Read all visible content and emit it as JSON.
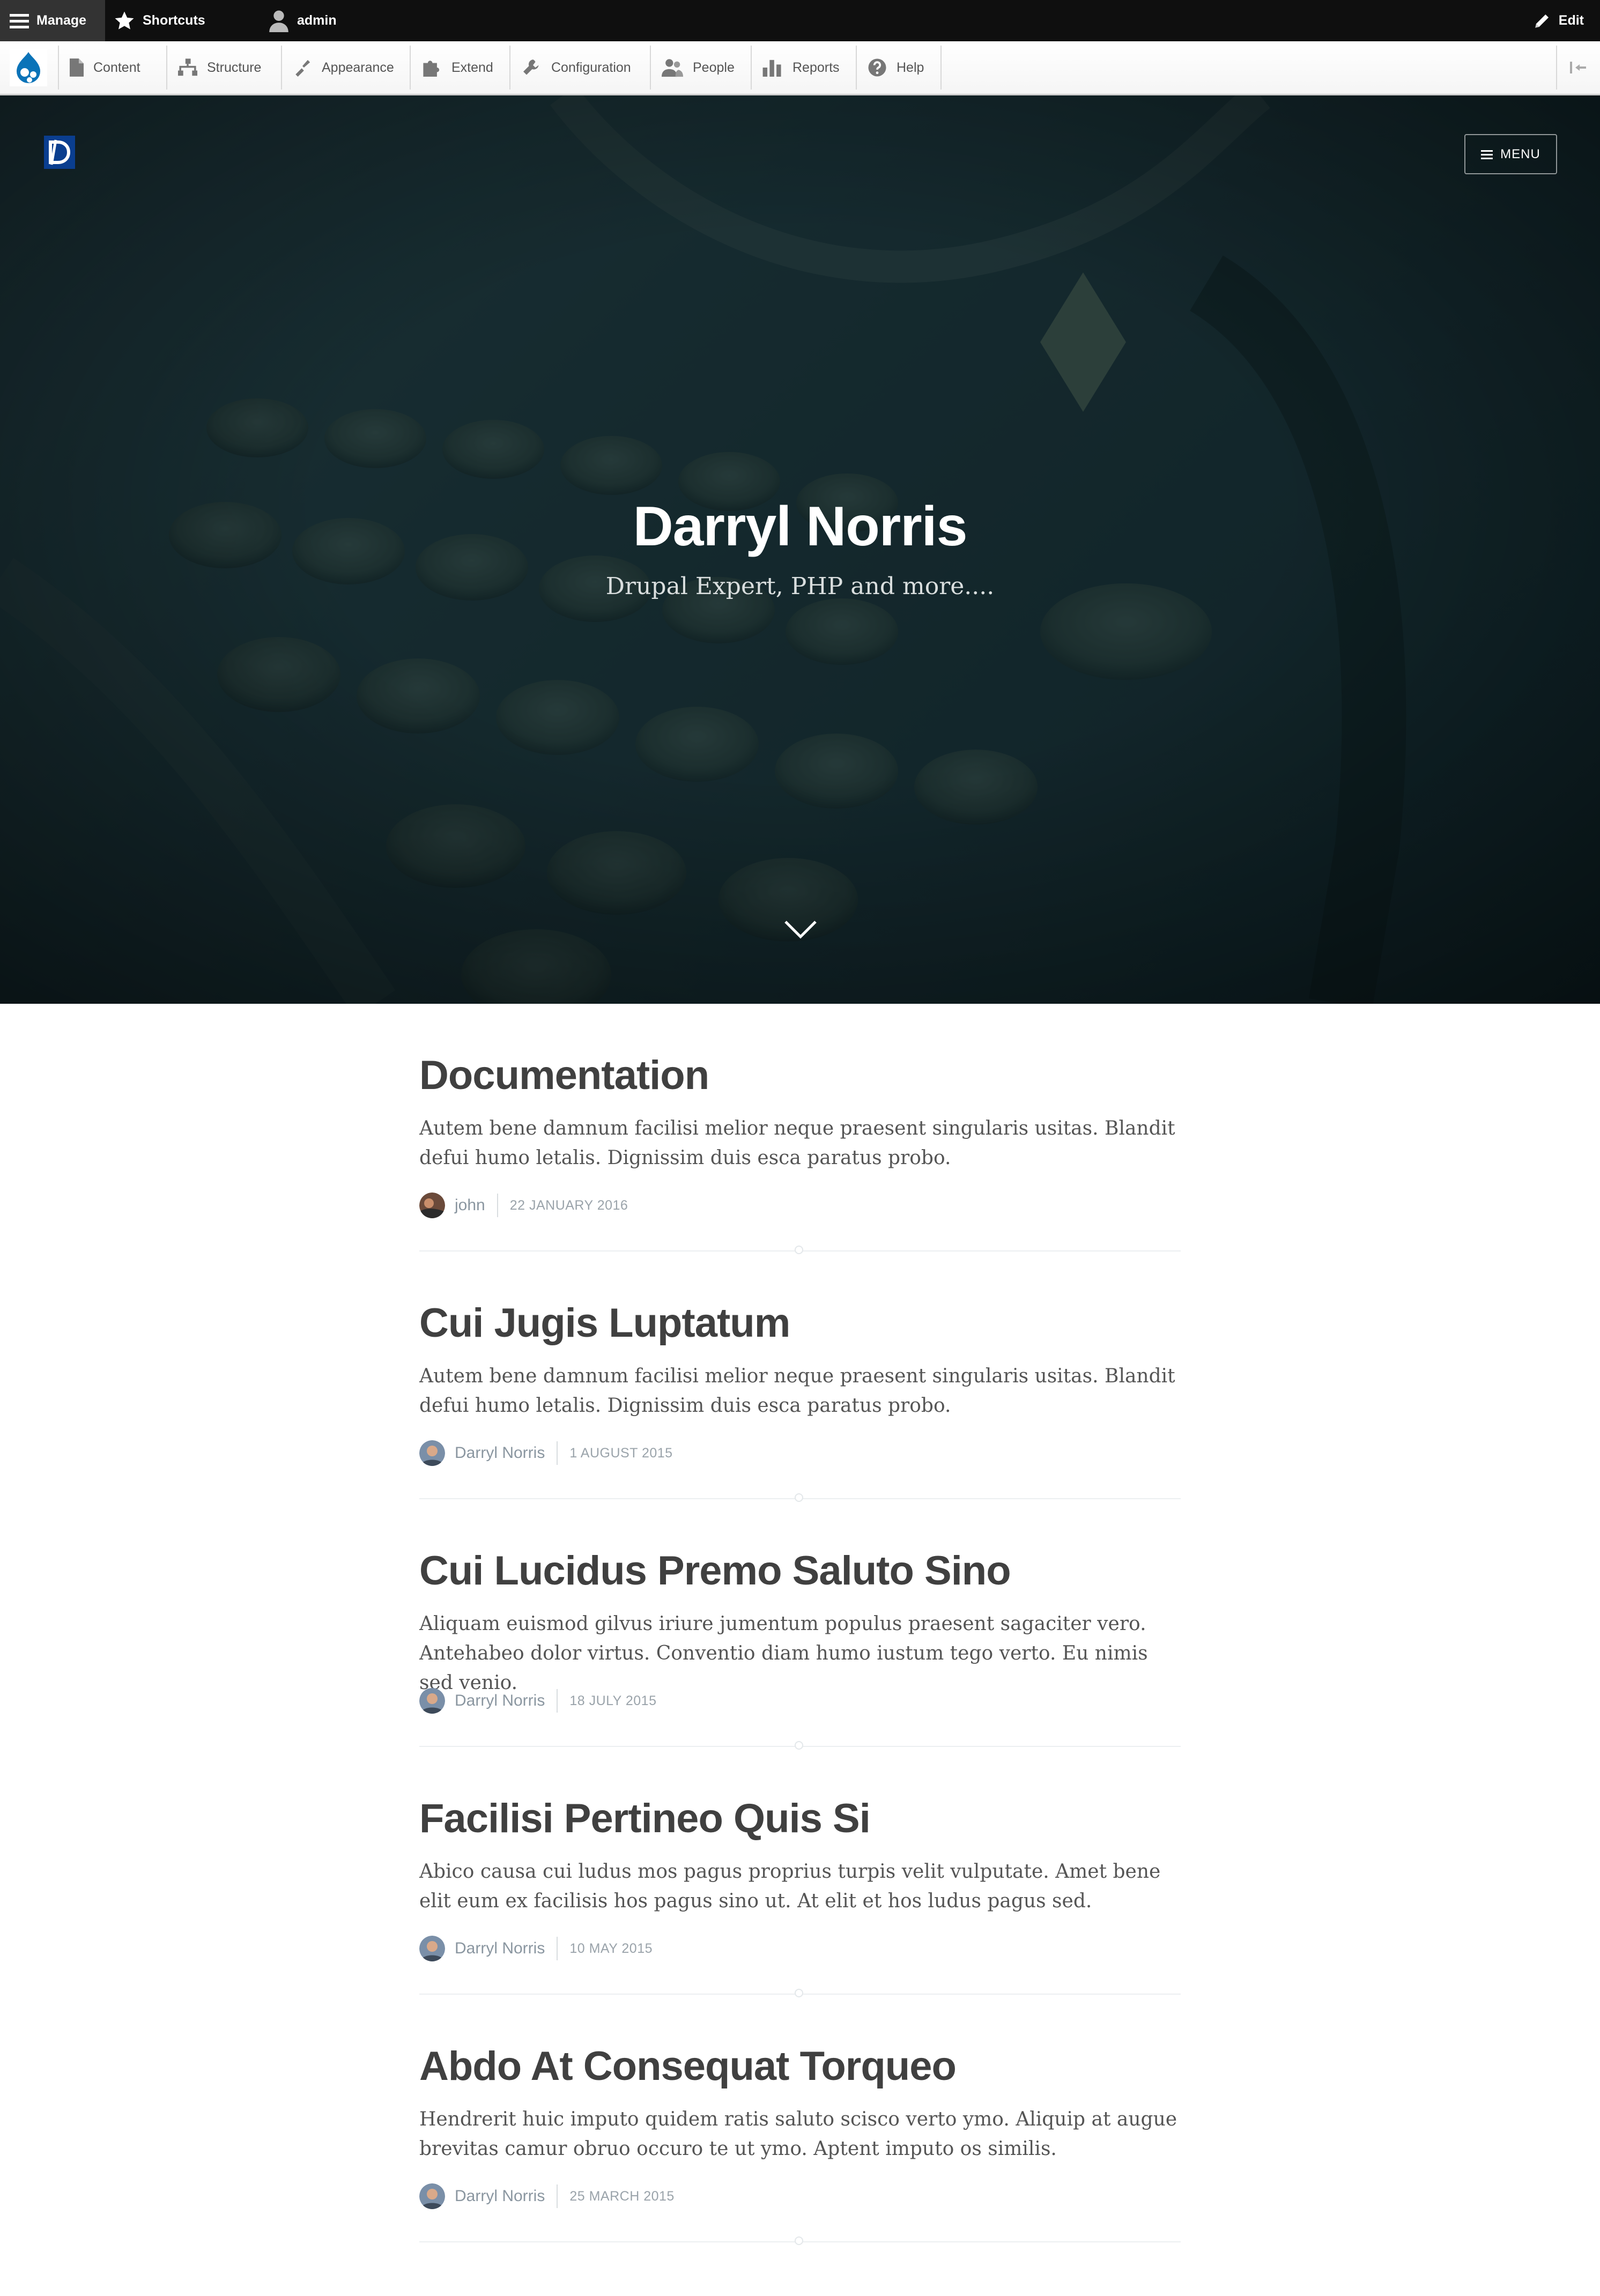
{
  "toolbar": {
    "manage": "Manage",
    "shortcuts": "Shortcuts",
    "user": "admin",
    "edit": "Edit"
  },
  "tray": {
    "items": [
      {
        "label": "Content",
        "icon": "file-icon"
      },
      {
        "label": "Structure",
        "icon": "structure-icon"
      },
      {
        "label": "Appearance",
        "icon": "brush-icon"
      },
      {
        "label": "Extend",
        "icon": "puzzle-icon"
      },
      {
        "label": "Configuration",
        "icon": "wrench-icon"
      },
      {
        "label": "People",
        "icon": "people-icon"
      },
      {
        "label": "Reports",
        "icon": "bar-chart-icon"
      },
      {
        "label": "Help",
        "icon": "help-icon"
      }
    ]
  },
  "hero": {
    "title": "Darryl Norris",
    "subtitle": "Drupal Expert, PHP and more....",
    "menu_label": "MENU"
  },
  "articles": [
    {
      "title": "Documentation",
      "body": "Autem bene damnum facilisi melior neque praesent singularis usitas. Blandit defui humo letalis. Dignissim duis esca paratus probo.",
      "author": "john",
      "date": "22 JANUARY 2016"
    },
    {
      "title": "Cui Jugis Luptatum",
      "body": "Autem bene damnum facilisi melior neque praesent singularis usitas. Blandit defui humo letalis. Dignissim duis esca paratus probo.",
      "author": "Darryl Norris",
      "date": "1 AUGUST 2015"
    },
    {
      "title": "Cui Lucidus Premo Saluto Sino",
      "body": "Aliquam euismod gilvus iriure jumentum populus praesent sagaciter vero. Antehabeo dolor virtus. Conventio diam humo iustum tego verto. Eu nimis sed venio.",
      "author": "Darryl Norris",
      "date": "18 JULY 2015"
    },
    {
      "title": "Facilisi Pertineo Quis Si",
      "body": "Abico causa cui ludus mos pagus proprius turpis velit vulputate. Amet bene elit eum ex facilisis hos pagus sino ut. At elit et hos ludus pagus sed.",
      "author": "Darryl Norris",
      "date": "10 MAY 2015"
    },
    {
      "title": "Abdo At Consequat Torqueo",
      "body": "Hendrerit huic imputo quidem ratis saluto scisco verto ymo. Aliquip at augue brevitas camur obruo occuro te ut ymo. Aptent imputo os similis.",
      "author": "Darryl Norris",
      "date": "25 MARCH 2015"
    }
  ],
  "colors": {
    "toolbar_bg": "#0f0f0f",
    "hero_bg": "#1a2a2e",
    "title_text": "#404040",
    "meta_text": "#8a96a0",
    "drupal_blue": "#0a73b8"
  }
}
